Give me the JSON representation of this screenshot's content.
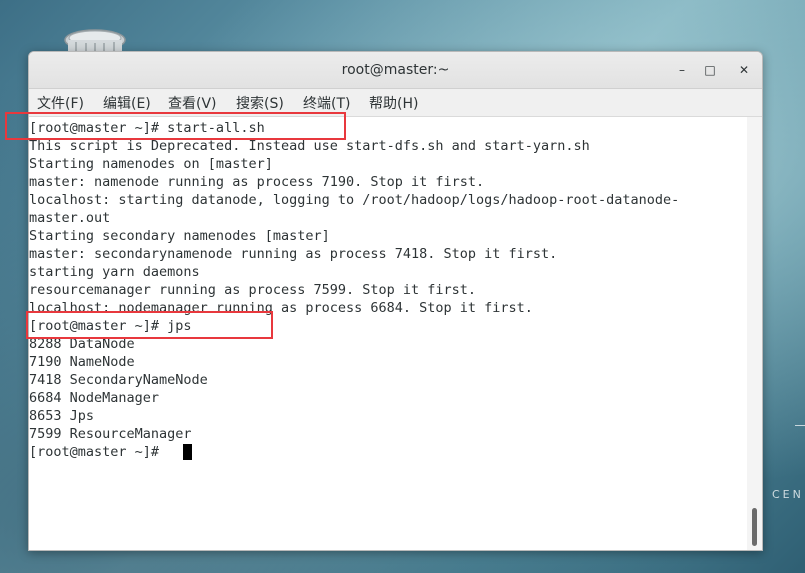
{
  "window": {
    "title": "root@master:~",
    "minimize_glyph": "–",
    "maximize_glyph": "□",
    "close_glyph": "✕"
  },
  "menu": {
    "items": [
      {
        "label": "文件(F)"
      },
      {
        "label": "编辑(E)"
      },
      {
        "label": "查看(V)"
      },
      {
        "label": "搜索(S)"
      },
      {
        "label": "终端(T)"
      },
      {
        "label": "帮助(H)"
      }
    ]
  },
  "terminal": {
    "lines": [
      "[root@master ~]# start-all.sh",
      "This script is Deprecated. Instead use start-dfs.sh and start-yarn.sh",
      "Starting namenodes on [master]",
      "master: namenode running as process 7190. Stop it first.",
      "localhost: starting datanode, logging to /root/hadoop/logs/hadoop-root-datanode-",
      "master.out",
      "Starting secondary namenodes [master]",
      "master: secondarynamenode running as process 7418. Stop it first.",
      "starting yarn daemons",
      "resourcemanager running as process 7599. Stop it first.",
      "localhost: nodemanager running as process 6684. Stop it first.",
      "[root@master ~]# jps",
      "8288 DataNode",
      "7190 NameNode",
      "7418 SecondaryNameNode",
      "6684 NodeManager",
      "8653 Jps",
      "7599 ResourceManager",
      "[root@master ~]# "
    ]
  },
  "desktop": {
    "corner_text": "CEN"
  },
  "colors": {
    "highlight_box": "#e8383d",
    "terminal_bg": "#ffffff",
    "terminal_text": "#2e3436"
  },
  "icons": {
    "trash": "trash-can-icon",
    "minimize": "minimize-icon",
    "maximize": "maximize-icon",
    "close": "close-icon"
  }
}
